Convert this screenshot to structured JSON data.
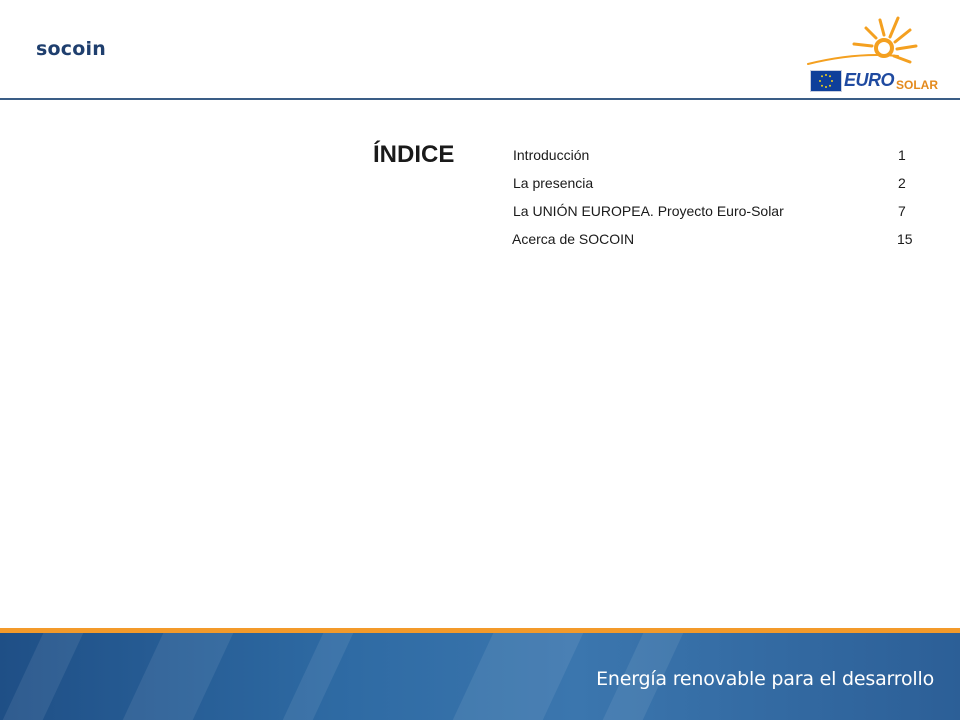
{
  "header": {
    "brand": "socoin",
    "logo": {
      "word_main": "EURO",
      "word_sub": "SOLAR",
      "flag_icon": "eu-flag-icon",
      "sun_icon": "sun-icon"
    }
  },
  "toc": {
    "title": "ÍNDICE",
    "items": [
      {
        "label": "Introducción",
        "page": "1"
      },
      {
        "label": "La presencia",
        "page": "2"
      },
      {
        "label": "La UNIÓN EUROPEA. Proyecto Euro-Solar",
        "page": "7"
      },
      {
        "label": "Acerca de SOCOIN",
        "page": "15"
      }
    ]
  },
  "footer": {
    "tagline": "Energía renovable para el desarrollo"
  },
  "colors": {
    "brand_blue": "#1f3f6e",
    "accent_orange": "#f39a2a",
    "footer_blue": "#2e6aa3"
  }
}
